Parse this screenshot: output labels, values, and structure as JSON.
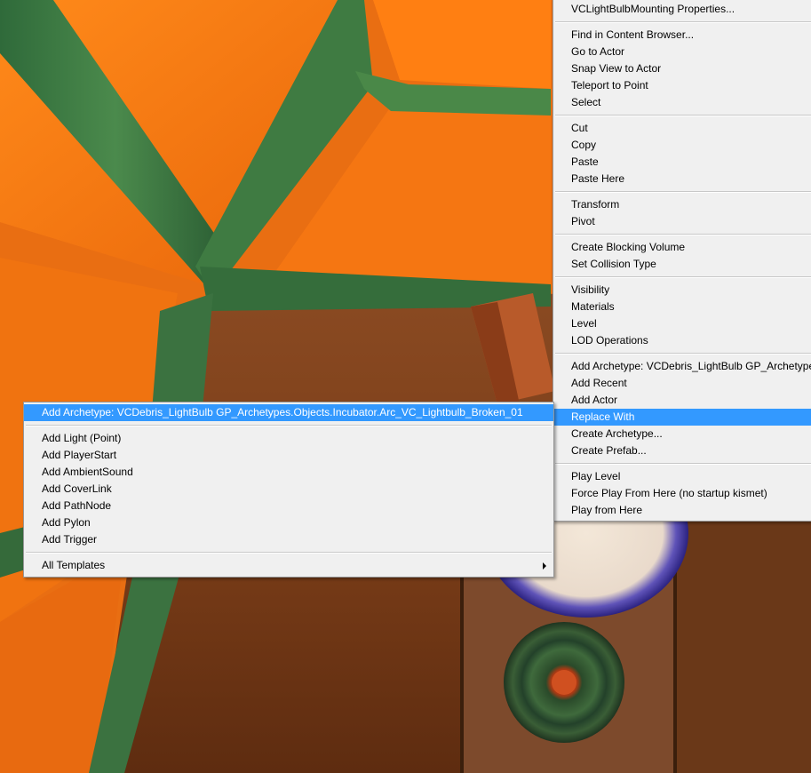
{
  "main_menu": {
    "items": [
      {
        "label": "VCLightBulbMounting Properties..."
      },
      {
        "sep": true
      },
      {
        "label": "Find in Content Browser..."
      },
      {
        "label": "Go to Actor"
      },
      {
        "label": "Snap View to Actor"
      },
      {
        "label": "Teleport to Point"
      },
      {
        "label": "Select"
      },
      {
        "sep": true
      },
      {
        "label": "Cut"
      },
      {
        "label": "Copy"
      },
      {
        "label": "Paste"
      },
      {
        "label": "Paste Here"
      },
      {
        "sep": true
      },
      {
        "label": "Transform"
      },
      {
        "label": "Pivot"
      },
      {
        "sep": true
      },
      {
        "label": "Create Blocking Volume"
      },
      {
        "label": "Set Collision Type"
      },
      {
        "sep": true
      },
      {
        "label": "Visibility"
      },
      {
        "label": "Materials"
      },
      {
        "label": "Level"
      },
      {
        "label": "LOD Operations"
      },
      {
        "sep": true
      },
      {
        "label": "Add Archetype: VCDebris_LightBulb GP_Archetypes"
      },
      {
        "label": "Add Recent"
      },
      {
        "label": "Add Actor"
      },
      {
        "label": "Replace With",
        "highlighted": true
      },
      {
        "label": "Create Archetype..."
      },
      {
        "label": "Create Prefab..."
      },
      {
        "sep": true
      },
      {
        "label": "Play Level"
      },
      {
        "label": "Force Play From Here (no startup kismet)"
      },
      {
        "label": "Play from Here"
      }
    ]
  },
  "sub_menu": {
    "items": [
      {
        "label": "Add Archetype: VCDebris_LightBulb GP_Archetypes.Objects.Incubator.Arc_VC_Lightbulb_Broken_01",
        "highlighted": true
      },
      {
        "sep": true
      },
      {
        "label": "Add Light (Point)"
      },
      {
        "label": "Add PlayerStart"
      },
      {
        "label": "Add AmbientSound"
      },
      {
        "label": "Add CoverLink"
      },
      {
        "label": "Add PathNode"
      },
      {
        "label": "Add Pylon"
      },
      {
        "label": "Add Trigger"
      },
      {
        "sep": true
      },
      {
        "label": "All Templates",
        "submenu": true
      }
    ]
  },
  "colors": {
    "highlight": "#3399ff",
    "menu_background": "#f0f0f0"
  }
}
